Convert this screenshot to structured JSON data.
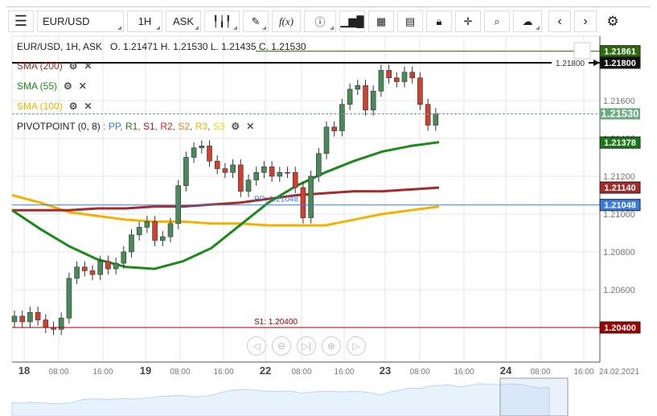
{
  "toolbar": {
    "symbol": "EUR/USD",
    "interval": "1H",
    "price_type": "ASK",
    "icons": [
      "menu-icon",
      "candles-icon",
      "pen-icon",
      "function-icon",
      "info-icon",
      "volume-bars-icon",
      "calendar-icon",
      "report-icon",
      "lock-icon",
      "crosshair-icon",
      "zoom-search-icon",
      "cloud-upload-icon",
      "chevron-left-icon",
      "chevron-right-icon",
      "gear-icon"
    ],
    "fx_label": "f(x)"
  },
  "header": {
    "ohlc": "EUR/USD, 1H, ASK   O. 1.21471 H. 1.21530 L. 1.21435 C. 1.21530"
  },
  "indicators": [
    {
      "label": "SMA (200)",
      "color": "#a52a2a"
    },
    {
      "label": "SMA (55)",
      "color": "#1a8a1a"
    },
    {
      "label": "SMA (100)",
      "color": "#f0b400"
    }
  ],
  "pivot": {
    "label": "PIVOTPOINT (0, 8)",
    "parts": [
      {
        "t": ": ",
        "c": "#555"
      },
      {
        "t": "PP",
        "c": "#3a7be0"
      },
      {
        "t": ", ",
        "c": "#555"
      },
      {
        "t": "R1",
        "c": "#1a7a1a"
      },
      {
        "t": ", ",
        "c": "#555"
      },
      {
        "t": "S1",
        "c": "#a51d1d"
      },
      {
        "t": ", ",
        "c": "#555"
      },
      {
        "t": "R2",
        "c": "#e02020"
      },
      {
        "t": ", ",
        "c": "#555"
      },
      {
        "t": "S2",
        "c": "#f08020"
      },
      {
        "t": ", ",
        "c": "#555"
      },
      {
        "t": "R3",
        "c": "#f0b400"
      },
      {
        "t": ", ",
        "c": "#555"
      },
      {
        "t": "S3",
        "c": "#e8e000"
      }
    ]
  },
  "chart_data": {
    "type": "candlestick",
    "ylim": [
      1.2035,
      1.2193
    ],
    "y_ticks": [
      "1.21800",
      "1.21600",
      "1.21400",
      "1.21200",
      "1.21000",
      "1.20800",
      "1.20600",
      "1.20400"
    ],
    "x_ticks": [
      {
        "l": "18",
        "b": true
      },
      {
        "l": "08:00"
      },
      {
        "l": "16:00"
      },
      {
        "l": "19",
        "b": true
      },
      {
        "l": "08:00"
      },
      {
        "l": "16:00"
      },
      {
        "l": "22",
        "b": true
      },
      {
        "l": "08:00"
      },
      {
        "l": "16:00"
      },
      {
        "l": "23",
        "b": true
      },
      {
        "l": "08:00"
      },
      {
        "l": "16:00"
      },
      {
        "l": "24",
        "b": true
      },
      {
        "l": "08:00"
      },
      {
        "l": "16:00"
      }
    ],
    "date_label": "24.02.2021",
    "closes": [
      1.2046,
      1.2043,
      1.2048,
      1.2044,
      1.204,
      1.2039,
      1.2045,
      1.2066,
      1.2072,
      1.207,
      1.2068,
      1.2075,
      1.2071,
      1.2074,
      1.208,
      1.2089,
      1.2093,
      1.2096,
      1.2086,
      1.2088,
      1.2095,
      1.2115,
      1.213,
      1.2135,
      1.2136,
      1.2128,
      1.2124,
      1.2122,
      1.2126,
      1.2112,
      1.2118,
      1.2122,
      1.2125,
      1.212,
      1.2122,
      1.2122,
      1.2114,
      1.2098,
      1.212,
      1.2132,
      1.2146,
      1.2144,
      1.2158,
      1.2166,
      1.2168,
      1.2155,
      1.2165,
      1.2176,
      1.2172,
      1.217,
      1.2175,
      1.2172,
      1.2158,
      1.2147,
      1.2153
    ],
    "sma200": [
      1.2102,
      1.2102,
      1.2102,
      1.2103,
      1.2103,
      1.2104,
      1.2104,
      1.2105,
      1.2106,
      1.2108,
      1.211,
      1.2111,
      1.2112,
      1.2112,
      1.2113,
      1.2114
    ],
    "sma55": [
      1.2102,
      1.2092,
      1.2083,
      1.2076,
      1.2072,
      1.2071,
      1.2075,
      1.2082,
      1.2094,
      1.2106,
      1.2115,
      1.2122,
      1.2128,
      1.2133,
      1.2136,
      1.2138
    ],
    "sma100": [
      1.211,
      1.2106,
      1.2101,
      1.2099,
      1.2097,
      1.2096,
      1.2096,
      1.2095,
      1.2095,
      1.2094,
      1.2094,
      1.2094,
      1.2097,
      1.21,
      1.2102,
      1.2104
    ],
    "levels": [
      {
        "name": "high-line",
        "value": 1.21861,
        "label": "1.21861",
        "color": "#2d6a0a"
      },
      {
        "name": "alert-line",
        "value": 1.218,
        "label": "1.21800",
        "color": "#111"
      },
      {
        "name": "last-price",
        "value": 1.2153,
        "label": "1.21530",
        "color": "#6aaa80"
      },
      {
        "name": "sma55-value",
        "value": 1.21378,
        "label": "1.21378",
        "color": "#1a7a1a"
      },
      {
        "name": "sma200-value",
        "value": 1.2114,
        "label": "1.21140",
        "color": "#a52a2a"
      },
      {
        "name": "pp",
        "value": 1.21048,
        "label": "1.21048",
        "color": "#3a7be0",
        "text": "PP: 1.21048"
      },
      {
        "name": "s1",
        "value": 1.204,
        "label": "1.20400",
        "color": "#a00000",
        "text": "S1: 1.20400"
      }
    ]
  }
}
